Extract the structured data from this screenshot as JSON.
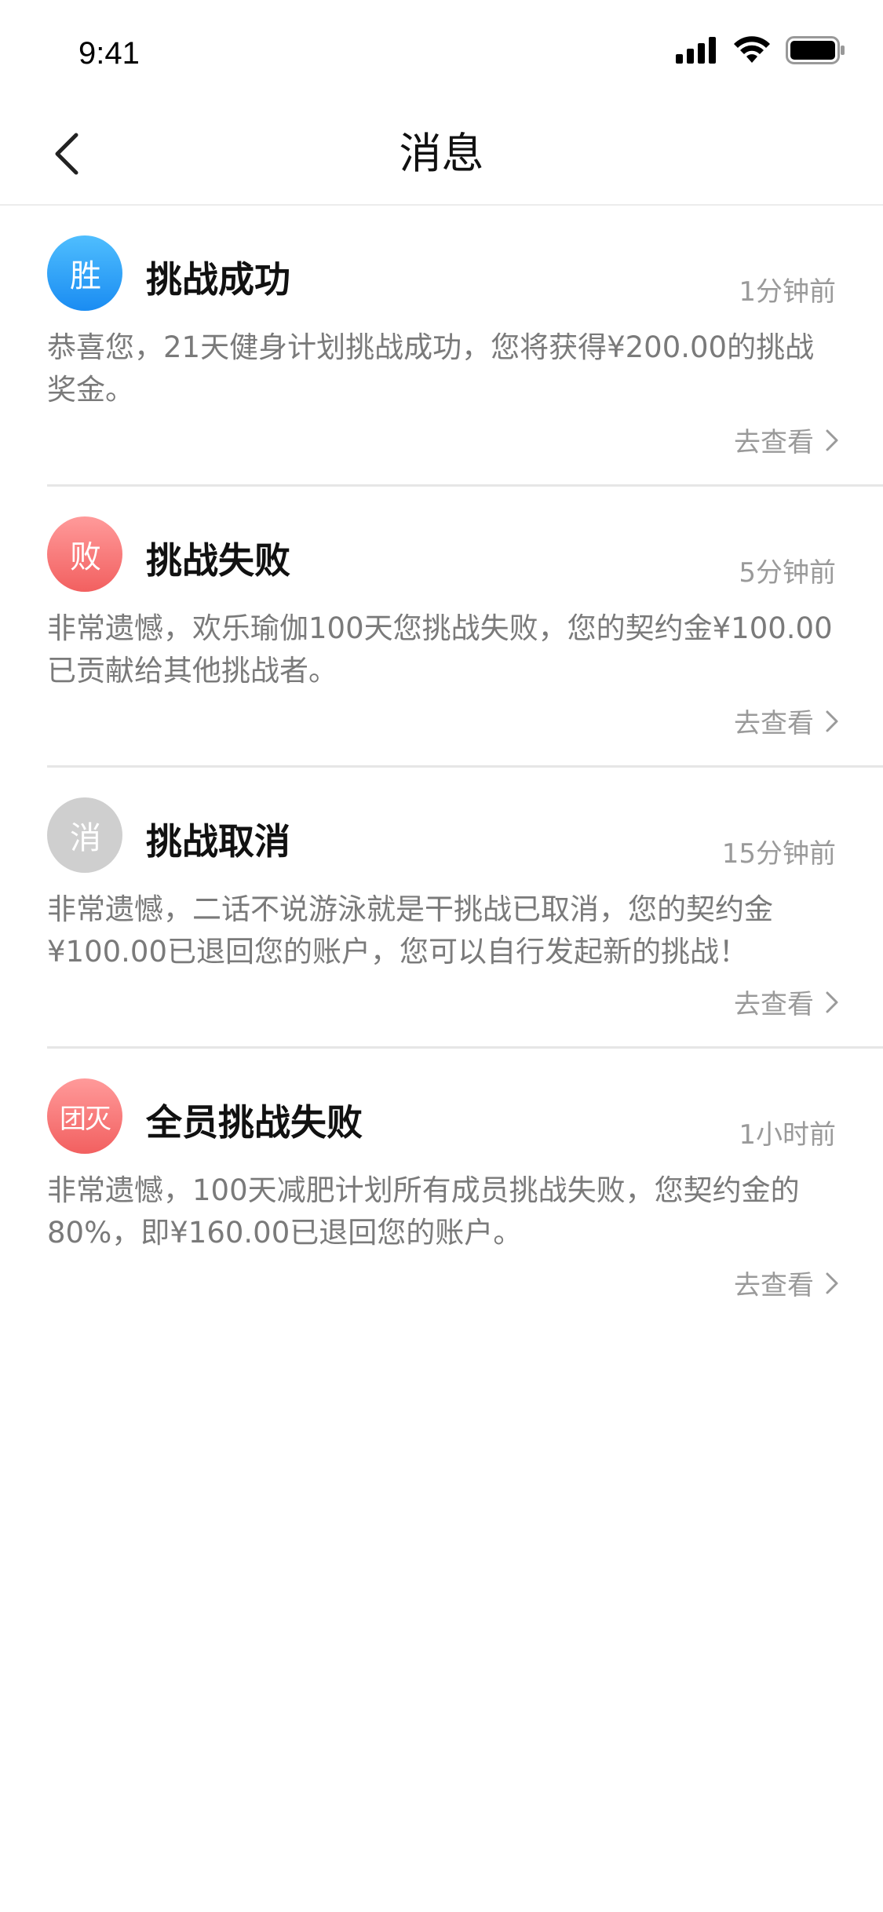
{
  "status_bar": {
    "time": "9:41"
  },
  "header": {
    "title": "消息",
    "back_icon": "chevron-left-icon"
  },
  "colors": {
    "win_badge": "#2196f3",
    "fail_badge": "#f26b6b",
    "cancel_badge": "#cfcfcf",
    "secondary_text": "#7a7a7a",
    "divider": "#e6e6e6"
  },
  "messages": [
    {
      "badge": "胜",
      "title": "挑战成功",
      "time": "1分钟前",
      "body": "恭喜您，21天健身计划挑战成功，您将获得¥200.00的挑战奖金。",
      "link": "去查看"
    },
    {
      "badge": "败",
      "title": "挑战失败",
      "time": "5分钟前",
      "body": "非常遗憾，欢乐瑜伽100天您挑战失败，您的契约金¥100.00已贡献给其他挑战者。",
      "link": "去查看"
    },
    {
      "badge": "消",
      "title": "挑战取消",
      "time": "15分钟前",
      "body": "非常遗憾，二话不说游泳就是干挑战已取消，您的契约金¥100.00已退回您的账户，您可以自行发起新的挑战！",
      "link": "去查看"
    },
    {
      "badge": "团灭",
      "title": "全员挑战失败",
      "time": "1小时前",
      "body": "非常遗憾，100天减肥计划所有成员挑战失败，您契约金的80%，即¥160.00已退回您的账户。",
      "link": "去查看"
    }
  ]
}
